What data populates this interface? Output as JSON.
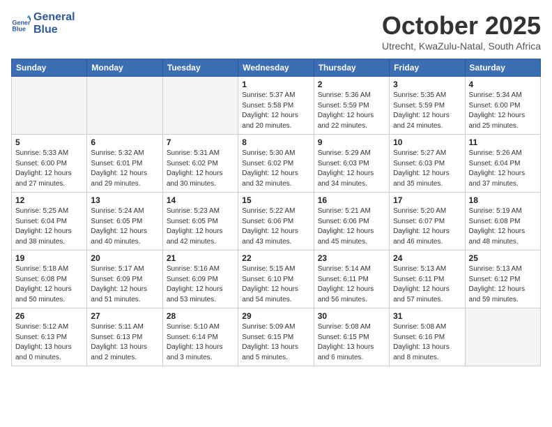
{
  "logo": {
    "line1": "General",
    "line2": "Blue"
  },
  "title": "October 2025",
  "subtitle": "Utrecht, KwaZulu-Natal, South Africa",
  "headers": [
    "Sunday",
    "Monday",
    "Tuesday",
    "Wednesday",
    "Thursday",
    "Friday",
    "Saturday"
  ],
  "weeks": [
    [
      {
        "num": "",
        "detail": ""
      },
      {
        "num": "",
        "detail": ""
      },
      {
        "num": "",
        "detail": ""
      },
      {
        "num": "1",
        "detail": "Sunrise: 5:37 AM\nSunset: 5:58 PM\nDaylight: 12 hours\nand 20 minutes."
      },
      {
        "num": "2",
        "detail": "Sunrise: 5:36 AM\nSunset: 5:59 PM\nDaylight: 12 hours\nand 22 minutes."
      },
      {
        "num": "3",
        "detail": "Sunrise: 5:35 AM\nSunset: 5:59 PM\nDaylight: 12 hours\nand 24 minutes."
      },
      {
        "num": "4",
        "detail": "Sunrise: 5:34 AM\nSunset: 6:00 PM\nDaylight: 12 hours\nand 25 minutes."
      }
    ],
    [
      {
        "num": "5",
        "detail": "Sunrise: 5:33 AM\nSunset: 6:00 PM\nDaylight: 12 hours\nand 27 minutes."
      },
      {
        "num": "6",
        "detail": "Sunrise: 5:32 AM\nSunset: 6:01 PM\nDaylight: 12 hours\nand 29 minutes."
      },
      {
        "num": "7",
        "detail": "Sunrise: 5:31 AM\nSunset: 6:02 PM\nDaylight: 12 hours\nand 30 minutes."
      },
      {
        "num": "8",
        "detail": "Sunrise: 5:30 AM\nSunset: 6:02 PM\nDaylight: 12 hours\nand 32 minutes."
      },
      {
        "num": "9",
        "detail": "Sunrise: 5:29 AM\nSunset: 6:03 PM\nDaylight: 12 hours\nand 34 minutes."
      },
      {
        "num": "10",
        "detail": "Sunrise: 5:27 AM\nSunset: 6:03 PM\nDaylight: 12 hours\nand 35 minutes."
      },
      {
        "num": "11",
        "detail": "Sunrise: 5:26 AM\nSunset: 6:04 PM\nDaylight: 12 hours\nand 37 minutes."
      }
    ],
    [
      {
        "num": "12",
        "detail": "Sunrise: 5:25 AM\nSunset: 6:04 PM\nDaylight: 12 hours\nand 38 minutes."
      },
      {
        "num": "13",
        "detail": "Sunrise: 5:24 AM\nSunset: 6:05 PM\nDaylight: 12 hours\nand 40 minutes."
      },
      {
        "num": "14",
        "detail": "Sunrise: 5:23 AM\nSunset: 6:05 PM\nDaylight: 12 hours\nand 42 minutes."
      },
      {
        "num": "15",
        "detail": "Sunrise: 5:22 AM\nSunset: 6:06 PM\nDaylight: 12 hours\nand 43 minutes."
      },
      {
        "num": "16",
        "detail": "Sunrise: 5:21 AM\nSunset: 6:06 PM\nDaylight: 12 hours\nand 45 minutes."
      },
      {
        "num": "17",
        "detail": "Sunrise: 5:20 AM\nSunset: 6:07 PM\nDaylight: 12 hours\nand 46 minutes."
      },
      {
        "num": "18",
        "detail": "Sunrise: 5:19 AM\nSunset: 6:08 PM\nDaylight: 12 hours\nand 48 minutes."
      }
    ],
    [
      {
        "num": "19",
        "detail": "Sunrise: 5:18 AM\nSunset: 6:08 PM\nDaylight: 12 hours\nand 50 minutes."
      },
      {
        "num": "20",
        "detail": "Sunrise: 5:17 AM\nSunset: 6:09 PM\nDaylight: 12 hours\nand 51 minutes."
      },
      {
        "num": "21",
        "detail": "Sunrise: 5:16 AM\nSunset: 6:09 PM\nDaylight: 12 hours\nand 53 minutes."
      },
      {
        "num": "22",
        "detail": "Sunrise: 5:15 AM\nSunset: 6:10 PM\nDaylight: 12 hours\nand 54 minutes."
      },
      {
        "num": "23",
        "detail": "Sunrise: 5:14 AM\nSunset: 6:11 PM\nDaylight: 12 hours\nand 56 minutes."
      },
      {
        "num": "24",
        "detail": "Sunrise: 5:13 AM\nSunset: 6:11 PM\nDaylight: 12 hours\nand 57 minutes."
      },
      {
        "num": "25",
        "detail": "Sunrise: 5:13 AM\nSunset: 6:12 PM\nDaylight: 12 hours\nand 59 minutes."
      }
    ],
    [
      {
        "num": "26",
        "detail": "Sunrise: 5:12 AM\nSunset: 6:13 PM\nDaylight: 13 hours\nand 0 minutes."
      },
      {
        "num": "27",
        "detail": "Sunrise: 5:11 AM\nSunset: 6:13 PM\nDaylight: 13 hours\nand 2 minutes."
      },
      {
        "num": "28",
        "detail": "Sunrise: 5:10 AM\nSunset: 6:14 PM\nDaylight: 13 hours\nand 3 minutes."
      },
      {
        "num": "29",
        "detail": "Sunrise: 5:09 AM\nSunset: 6:15 PM\nDaylight: 13 hours\nand 5 minutes."
      },
      {
        "num": "30",
        "detail": "Sunrise: 5:08 AM\nSunset: 6:15 PM\nDaylight: 13 hours\nand 6 minutes."
      },
      {
        "num": "31",
        "detail": "Sunrise: 5:08 AM\nSunset: 6:16 PM\nDaylight: 13 hours\nand 8 minutes."
      },
      {
        "num": "",
        "detail": ""
      }
    ]
  ]
}
